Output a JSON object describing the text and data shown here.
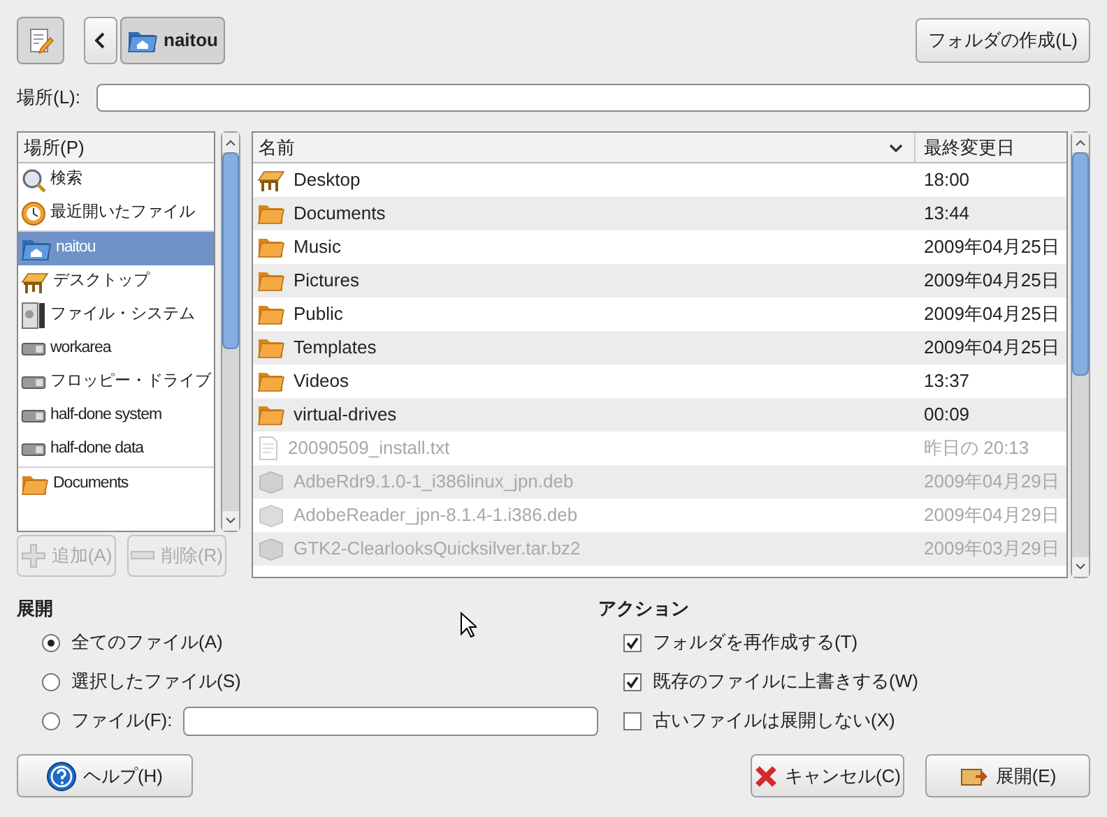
{
  "toolbar": {
    "path": [
      {
        "label": "naitou",
        "selected": true
      }
    ],
    "create_folder": "フォルダの作成(L)"
  },
  "location": {
    "label": "場所(L):"
  },
  "places": {
    "header": "場所(P)",
    "groups": [
      [
        {
          "label": "検索",
          "kind": "search",
          "selected": false
        },
        {
          "label": "最近開いたファイル",
          "kind": "recent",
          "selected": false
        }
      ],
      [
        {
          "label": "naitou",
          "kind": "home",
          "selected": true
        },
        {
          "label": "デスクトップ",
          "kind": "desktop",
          "selected": false
        },
        {
          "label": "ファイル・システム",
          "kind": "filesystem",
          "selected": false
        },
        {
          "label": "workarea",
          "kind": "drive",
          "selected": false
        },
        {
          "label": "フロッピー・ドライブ",
          "kind": "drive",
          "selected": false
        },
        {
          "label": "half-done system",
          "kind": "drive",
          "selected": false
        },
        {
          "label": "half-done data",
          "kind": "drive",
          "selected": false
        }
      ],
      [
        {
          "label": "Documents",
          "kind": "folder",
          "selected": false
        }
      ]
    ],
    "add_button": {
      "label": "追加(A)",
      "disabled": true
    },
    "remove_button": {
      "label": "削除(R)",
      "disabled": true
    }
  },
  "files": {
    "columns": [
      "名前",
      "最終変更日"
    ],
    "rows": [
      {
        "name": "Desktop",
        "modified": "18:00",
        "kind": "desktop",
        "dimmed": false
      },
      {
        "name": "Documents",
        "modified": "13:44",
        "kind": "folder",
        "dimmed": false
      },
      {
        "name": "Music",
        "modified": "2009年04月25日",
        "kind": "folder",
        "dimmed": false
      },
      {
        "name": "Pictures",
        "modified": "2009年04月25日",
        "kind": "folder",
        "dimmed": false
      },
      {
        "name": "Public",
        "modified": "2009年04月25日",
        "kind": "folder",
        "dimmed": false
      },
      {
        "name": "Templates",
        "modified": "2009年04月25日",
        "kind": "folder",
        "dimmed": false
      },
      {
        "name": "Videos",
        "modified": "13:37",
        "kind": "folder",
        "dimmed": false
      },
      {
        "name": "virtual-drives",
        "modified": "00:09",
        "kind": "folder",
        "dimmed": false
      },
      {
        "name": "20090509_install.txt",
        "modified": "昨日の 20:13",
        "kind": "text",
        "dimmed": true
      },
      {
        "name": "AdbeRdr9.1.0-1_i386linux_jpn.deb",
        "modified": "2009年04月29日",
        "kind": "package",
        "dimmed": true
      },
      {
        "name": "AdobeReader_jpn-8.1.4-1.i386.deb",
        "modified": "2009年04月29日",
        "kind": "package",
        "dimmed": true
      },
      {
        "name": "GTK2-ClearlooksQuicksilver.tar.bz2",
        "modified": "2009年03月29日",
        "kind": "package",
        "dimmed": true
      }
    ]
  },
  "extract": {
    "title": "展開",
    "options": [
      {
        "label": "全てのファイル(A)",
        "kind": "plain",
        "selected": true
      },
      {
        "label": "選択したファイル(S)",
        "kind": "plain",
        "selected": false
      },
      {
        "label": "ファイル(F):",
        "kind": "field",
        "selected": false
      }
    ]
  },
  "actions": {
    "title": "アクション",
    "options": [
      {
        "label": "フォルダを再作成する(T)",
        "checked": true
      },
      {
        "label": "既存のファイルに上書きする(W)",
        "checked": true
      },
      {
        "label": "古いファイルは展開しない(X)",
        "checked": false
      }
    ]
  },
  "buttons": {
    "help": "ヘルプ(H)",
    "cancel": "キャンセル(C)",
    "extract": "展開(E)"
  }
}
